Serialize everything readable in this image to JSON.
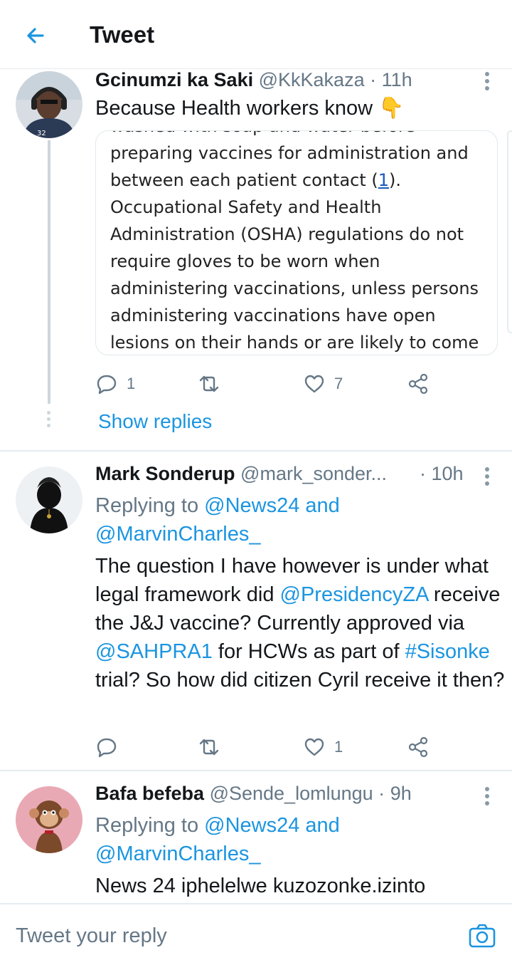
{
  "header": {
    "title": "Tweet"
  },
  "tweets": [
    {
      "name": "Gcinumzi ka Saki",
      "handle": "@KkKakaza",
      "dot": "·",
      "time": "11h",
      "text": "Because Health workers know 👇",
      "image_text": {
        "line0": "washed with soap and water before",
        "line1": "preparing vaccines for administration and",
        "line2a": "between each patient contact (",
        "line2b": "1",
        "line2c": ").",
        "line3": "Occupational Safety and Health",
        "line4": "Administration (OSHA) regulations do not",
        "line5": "require gloves to be worn when",
        "line6": "administering vaccinations, unless persons",
        "line7": "administering vaccinations have open",
        "line8": "lesions on their hands or are likely to come"
      },
      "reply_count": "1",
      "retweet_count": "",
      "like_count": "7",
      "show_replies": "Show replies"
    },
    {
      "name": "Mark Sonderup",
      "handle": "@mark_sonder...",
      "dot": "·",
      "time": "10h",
      "replying_prefix": "Replying to",
      "replying_to_1": "@News24 and",
      "replying_to_2": "@MarvinCharles_",
      "text_parts": {
        "p1": "The question I have however is under what legal framework did ",
        "m1": "@PresidencyZA",
        "p2": " receive the J&J vaccine? Currently approved via ",
        "m2": "@SAHPRA1",
        "p3": " for HCWs as part of ",
        "m3": "#Sisonke",
        "p4": " trial? So how did citizen Cyril receive it then?"
      },
      "reply_count": "",
      "retweet_count": "",
      "like_count": "1"
    },
    {
      "name": "Bafa befeba",
      "handle": "@Sende_lomlungu",
      "dot": "·",
      "time": "9h",
      "replying_prefix": "Replying to",
      "replying_to_1": "@News24 and",
      "replying_to_2": "@MarvinCharles_",
      "text": "News 24 iphelelwe kuzozonke.izinto"
    }
  ],
  "compose": {
    "placeholder": "Tweet your reply"
  },
  "colors": {
    "accent": "#1b95e0",
    "muted": "#657786",
    "divider": "#e6ecf0"
  },
  "icons": [
    "back-arrow-icon",
    "more-vertical-icon",
    "reply-icon",
    "retweet-icon",
    "like-icon",
    "share-icon",
    "camera-icon"
  ]
}
